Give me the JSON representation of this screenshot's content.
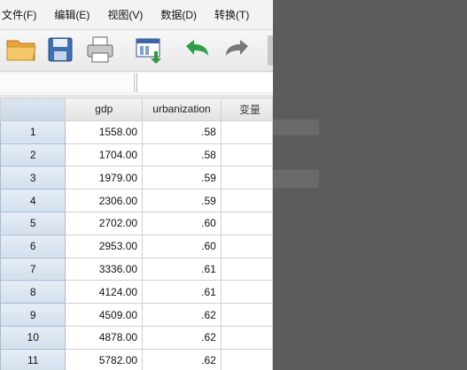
{
  "menu": [
    "文件(F)",
    "编辑(E)",
    "视图(V)",
    "数据(D)",
    "转换(T)"
  ],
  "toolbar": {
    "icons": [
      "open-folder-icon",
      "save-icon",
      "print-icon",
      "dialog-recall-icon",
      "undo-icon",
      "redo-icon"
    ]
  },
  "grid": {
    "columns": [
      "gdp",
      "urbanization",
      "变量"
    ],
    "rows": [
      {
        "n": "1",
        "gdp": "1558.00",
        "urbanization": ".58"
      },
      {
        "n": "2",
        "gdp": "1704.00",
        "urbanization": ".58"
      },
      {
        "n": "3",
        "gdp": "1979.00",
        "urbanization": ".59"
      },
      {
        "n": "4",
        "gdp": "2306.00",
        "urbanization": ".59"
      },
      {
        "n": "5",
        "gdp": "2702.00",
        "urbanization": ".60"
      },
      {
        "n": "6",
        "gdp": "2953.00",
        "urbanization": ".60"
      },
      {
        "n": "7",
        "gdp": "3336.00",
        "urbanization": ".61"
      },
      {
        "n": "8",
        "gdp": "4124.00",
        "urbanization": ".61"
      },
      {
        "n": "9",
        "gdp": "4509.00",
        "urbanization": ".62"
      },
      {
        "n": "10",
        "gdp": "4878.00",
        "urbanization": ".62"
      },
      {
        "n": "11",
        "gdp": "5782.00",
        "urbanization": ".62"
      }
    ]
  },
  "colors": {
    "row_header": "#d3dfec",
    "background": "#5f5f5f"
  }
}
